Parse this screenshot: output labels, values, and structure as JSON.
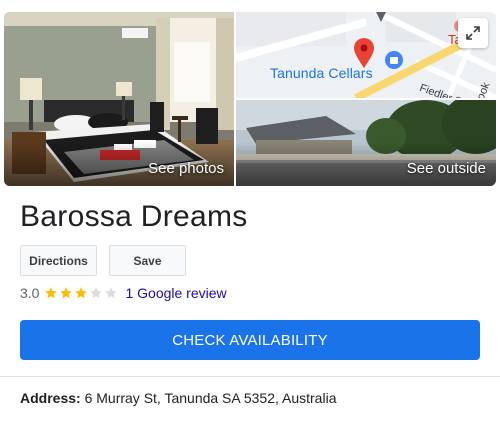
{
  "media": {
    "see_photos_label": "See photos",
    "see_outside_label": "See outside",
    "map": {
      "place_label": "Tanunda Cellars",
      "street_1": "Fiedler St",
      "street_2": "Kook St",
      "corner_label": "Ta",
      "pin_color": "#ea4335",
      "road_color": "#f9d66e"
    }
  },
  "listing": {
    "title": "Barossa Dreams",
    "directions_label": "Directions",
    "save_label": "Save",
    "rating_value": "3.0",
    "rating_stars": 3,
    "rating_max": 5,
    "review_link": "1 Google review",
    "cta_label": "CHECK AVAILABILITY",
    "address_label": "Address:",
    "address_value": " 6 Murray St, Tanunda SA 5352, Australia"
  },
  "colors": {
    "accent": "#1a73e8",
    "star_filled": "#fbbc04",
    "star_empty": "#dadce0",
    "link": "#1a0dab"
  }
}
